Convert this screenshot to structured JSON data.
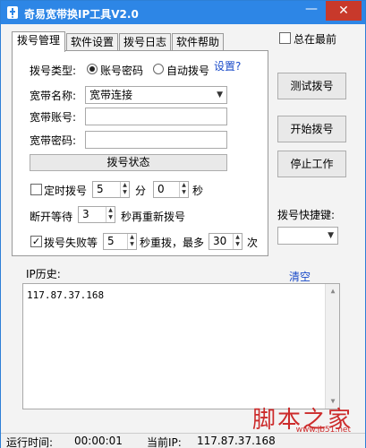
{
  "window": {
    "title": "奇易宽带换IP工具V2.0",
    "close_glyph": "✕",
    "minimize_glyph": "—"
  },
  "tabs": [
    {
      "label": "拨号管理",
      "active": true
    },
    {
      "label": "软件设置",
      "active": false
    },
    {
      "label": "拨号日志",
      "active": false
    },
    {
      "label": "软件帮助",
      "active": false
    }
  ],
  "always_on_top": {
    "label": "总在最前",
    "checked": false
  },
  "dial_panel": {
    "dial_type_label": "拨号类型:",
    "radio_account": {
      "label": "账号密码",
      "selected": true
    },
    "radio_auto": {
      "label": "自动拨号",
      "selected": false
    },
    "settings_link": "设置?",
    "broadband_name_label": "宽带名称:",
    "broadband_name_value": "宽带连接",
    "broadband_account_label": "宽带账号:",
    "broadband_account_value": "",
    "broadband_password_label": "宽带密码:",
    "broadband_password_value": "",
    "dial_status_button": "拨号状态",
    "timed_dial": {
      "label": "定时拨号",
      "checked": false,
      "minutes": "5",
      "minutes_unit": "分",
      "seconds": "0",
      "seconds_unit": "秒"
    },
    "disconnect_wait": {
      "label": "断开等待",
      "value": "3",
      "suffix": "秒再重新拨号"
    },
    "retry": {
      "label": "拨号失败等",
      "checked": true,
      "value": "5",
      "middle": "秒重拨，最多",
      "max": "30",
      "unit": "次"
    }
  },
  "right_panel": {
    "test_dial_button": "测试拨号",
    "start_dial_button": "开始拨号",
    "stop_button": "停止工作",
    "hotkey_label": "拨号快捷键:",
    "hotkey_value": ""
  },
  "history": {
    "label": "IP历史:",
    "clear_link": "清空",
    "entries": [
      "117.87.37.168"
    ]
  },
  "statusbar": {
    "runtime_label": "运行时间:",
    "runtime_value": "00:00:01",
    "current_ip_label": "当前IP:",
    "current_ip_value": "117.87.37.168"
  },
  "watermark": {
    "text": "脚本之家",
    "url": "www.jb51.net"
  }
}
